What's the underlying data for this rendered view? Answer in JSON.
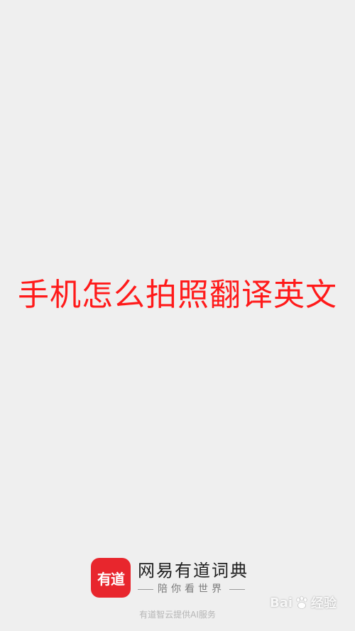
{
  "headline": "手机怎么拍照翻译英文",
  "brand": {
    "logo_text": "有道",
    "name": "网易有道词典",
    "slogan": "陪你看世界"
  },
  "footer": {
    "provider": "有道智云提供AI服务"
  },
  "watermark": {
    "left": "Bai",
    "right": "经验"
  },
  "colors": {
    "background": "#efefef",
    "headline": "#ff1a1a",
    "logo": "#e8262d"
  }
}
